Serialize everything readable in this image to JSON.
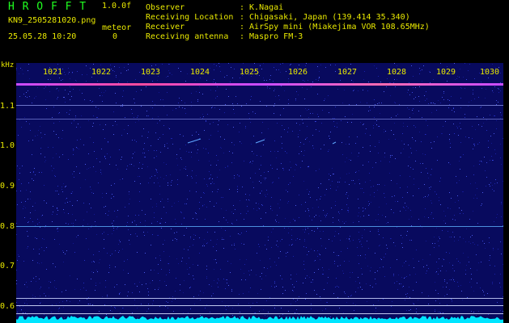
{
  "header": {
    "app_title": "H R O F F T",
    "version": "1.0.0f",
    "filename": "KN9_2505281020.png",
    "datetime": "25.05.28 10:20",
    "counter_label": "meteor",
    "counter_value": "0"
  },
  "info": [
    {
      "key": "Observer",
      "value": ": K.Nagai"
    },
    {
      "key": "Receiving Location",
      "value": ": Chigasaki, Japan (139.414 35.340)"
    },
    {
      "key": "Receiver",
      "value": ": AirSpy mini (Miakejima VOR 108.65MHz)"
    },
    {
      "key": "Receiving antenna",
      "value": ": Maspro FM-3"
    }
  ],
  "y_axis": {
    "unit": "kHz",
    "ticks": [
      "1.1",
      "1.0",
      "0.9",
      "0.8",
      "0.7",
      "0.6"
    ]
  },
  "x_axis": {
    "ticks": [
      "1021",
      "1022",
      "1023",
      "1024",
      "1025",
      "1026",
      "1027",
      "1028",
      "1029",
      "1030"
    ]
  },
  "colors": {
    "text": "#e8e800",
    "title": "#20ff20",
    "background": "#000000",
    "spectrogram": "#080a5e",
    "spectrum_trace": "#00e5ff"
  }
}
